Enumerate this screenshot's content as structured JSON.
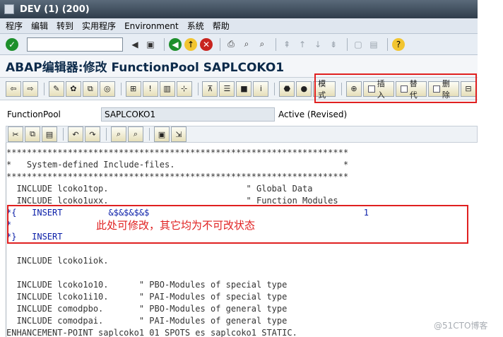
{
  "window": {
    "title": "DEV (1) (200)"
  },
  "menu": [
    "程序",
    "编辑",
    "转到",
    "实用程序",
    "Environment",
    "系统",
    "帮助"
  ],
  "header": {
    "title": "ABAP编辑器:修改 FunctionPool SAPLCOKO1"
  },
  "toolbar": {
    "insert_label": "插入",
    "replace_label": "替代",
    "delete_label": "删除",
    "mode_label": "模式"
  },
  "field": {
    "label": "FunctionPool",
    "value": "SAPLCOKO1",
    "status": "Active (Revised)"
  },
  "code": [
    "*******************************************************************",
    "*   System-defined Include-files.                                 *",
    "*******************************************************************",
    "  INCLUDE lcoko1top.                           \" Global Data",
    "  INCLUDE lcoko1uxx.                           \" Function Modules",
    "*{   INSERT         &$&$&$&$                                          1",
    "*",
    "*}   INSERT",
    "",
    "  INCLUDE lcoko1iok.",
    "",
    "  INCLUDE lcoko1o10.      \" PBO-Modules of special type",
    "  INCLUDE lcoko1i10.      \" PAI-Modules of special type",
    "  INCLUDE comodpbo.       \" PBO-Modules of general type",
    "  INCLUDE comodpai.       \" PAI-Modules of general type",
    "ENHANCEMENT-POINT saplcoko1_01 SPOTS es_saplcoko1 STATIC."
  ],
  "annotation": "此处可修改，其它均为不可改状态",
  "watermark": "@51CTO博客"
}
